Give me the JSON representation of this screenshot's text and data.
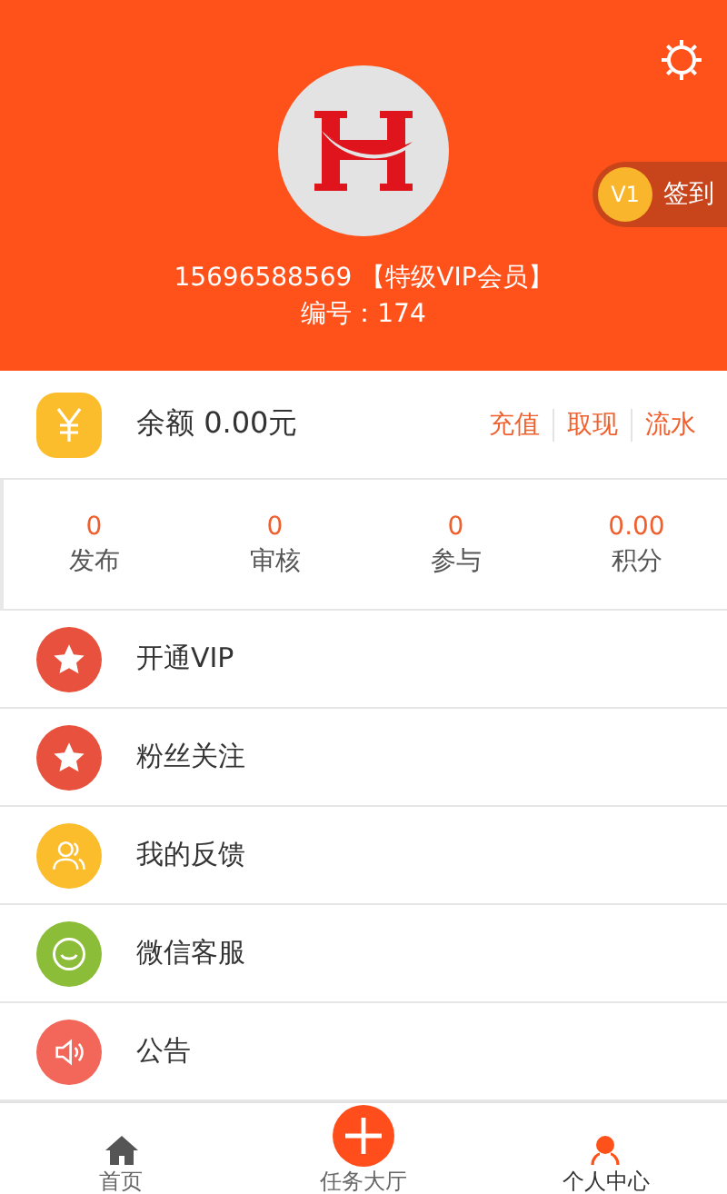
{
  "header": {
    "phone": "15696588569",
    "member_level": "【特级VIP会员】",
    "member_id": "编号：174",
    "checkin": {
      "level_badge": "V1",
      "label": "签到"
    }
  },
  "balance": {
    "label": "余额 0.00元",
    "actions": [
      "充值",
      "取现",
      "流水"
    ]
  },
  "stats": [
    {
      "value": "0",
      "label": "发布"
    },
    {
      "value": "0",
      "label": "审核"
    },
    {
      "value": "0",
      "label": "参与"
    },
    {
      "value": "0.00",
      "label": "积分"
    }
  ],
  "menu": [
    {
      "kind": "star",
      "label": "开通VIP",
      "color": "#e8513d"
    },
    {
      "kind": "star",
      "label": "粉丝关注",
      "color": "#e8513d"
    },
    {
      "kind": "people",
      "label": "我的反馈",
      "color": "#fbbd2c"
    },
    {
      "kind": "chat",
      "label": "微信客服",
      "color": "#8cbd38"
    },
    {
      "kind": "speaker",
      "label": "公告",
      "color": "#f2675a"
    }
  ],
  "tab_bar": [
    {
      "kind": "home",
      "label": "首页",
      "selected": false
    },
    {
      "kind": "plus",
      "label": "任务大厅",
      "selected": false
    },
    {
      "kind": "person",
      "label": "个人中心",
      "selected": true
    }
  ]
}
